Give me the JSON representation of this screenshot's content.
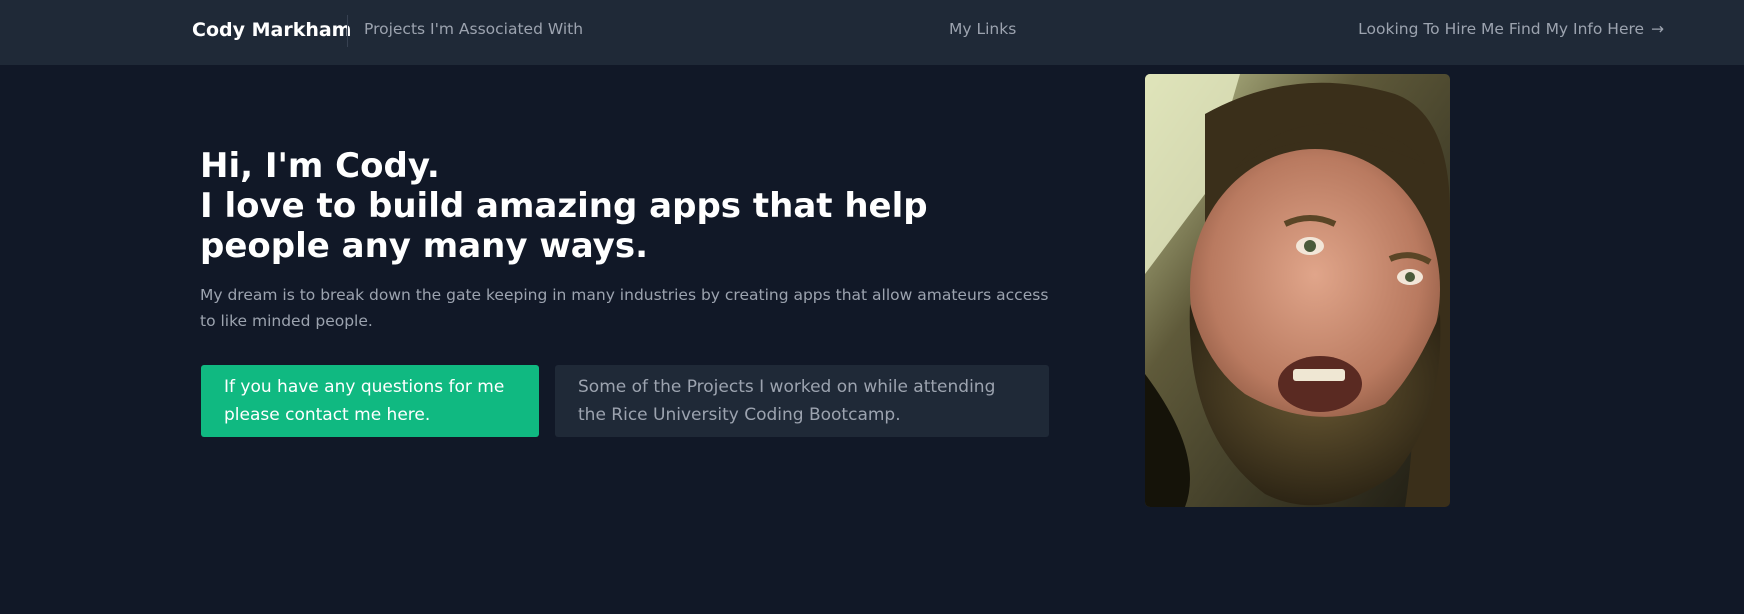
{
  "nav": {
    "brand": "Cody Markham",
    "projects_link": "Projects I'm Associated With",
    "my_links": "My Links",
    "hire_link": "Looking To Hire Me Find My Info Here",
    "hire_arrow": "→"
  },
  "hero": {
    "greeting": "Hi, I'm Cody.",
    "tagline": "I love to build amazing apps that help people any many ways.",
    "description": "My dream is to break down the gate keeping in many industries by creating apps that allow amateurs access to like minded people.",
    "contact_button": "If you have any questions for me please contact me here.",
    "projects_button": "Some of the Projects I worked on while attending the Rice University Coding Bootcamp."
  },
  "colors": {
    "background": "#111827",
    "navbar": "#1f2937",
    "accent": "#10b981",
    "muted_text": "#9ca3af"
  },
  "icons": {
    "hire_arrow": "arrow-right-icon"
  }
}
